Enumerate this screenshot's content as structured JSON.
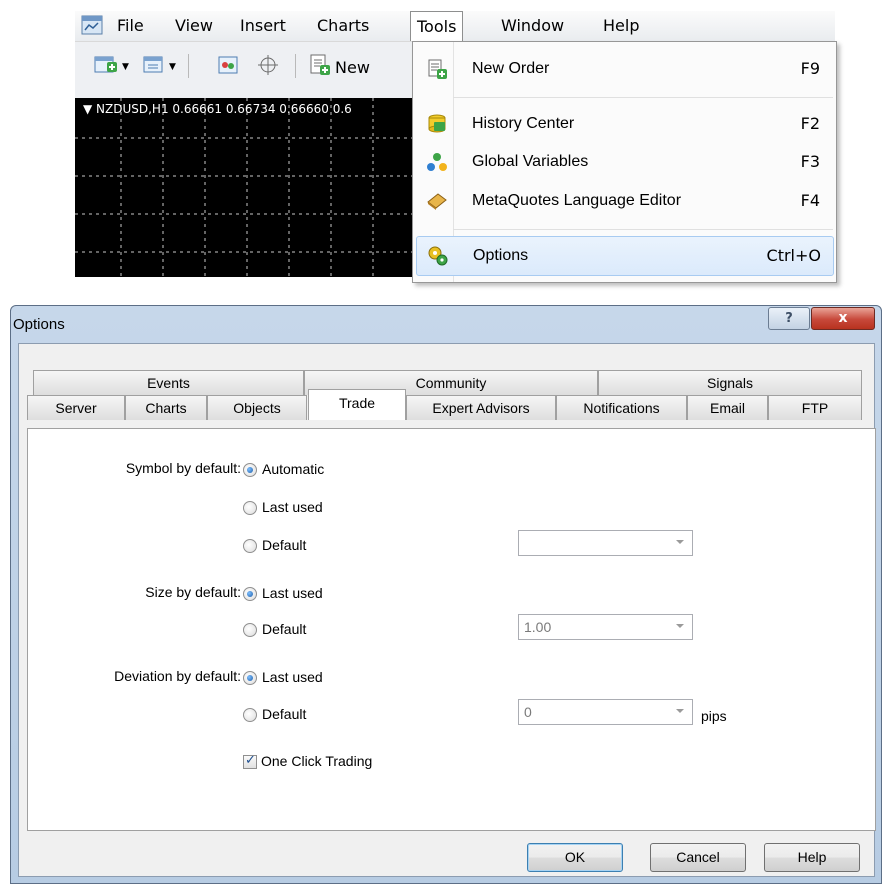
{
  "menubar": {
    "items": [
      "File",
      "View",
      "Insert",
      "Charts",
      "Tools",
      "Window",
      "Help"
    ],
    "open_item": "Tools"
  },
  "toolbar": {
    "new_order_partial": "New"
  },
  "chart": {
    "label": "▼ NZDUSD,H1  0.66661 0.66734 0.66660 0.6"
  },
  "tools_menu": {
    "items": [
      {
        "label": "New Order",
        "shortcut": "F9",
        "icon": "new-order-icon"
      },
      {
        "label": "History Center",
        "shortcut": "F2",
        "icon": "history-center-icon"
      },
      {
        "label": "Global Variables",
        "shortcut": "F3",
        "icon": "global-variables-icon"
      },
      {
        "label": "MetaQuotes Language Editor",
        "shortcut": "F4",
        "icon": "metaeditor-icon"
      },
      {
        "label": "Options",
        "shortcut": "Ctrl+O",
        "icon": "options-icon"
      }
    ],
    "selected": "Options"
  },
  "dialog": {
    "title": "Options",
    "help_button": "?",
    "close_button": "x",
    "tabs_row1": [
      "Events",
      "Community",
      "Signals"
    ],
    "tabs_row2": [
      "Server",
      "Charts",
      "Objects",
      "Trade",
      "Expert Advisors",
      "Notifications",
      "Email",
      "FTP"
    ],
    "active_tab": "Trade",
    "symbol": {
      "label": "Symbol by default:",
      "options": [
        "Automatic",
        "Last used",
        "Default"
      ],
      "selected": "Automatic",
      "combo_value": ""
    },
    "size": {
      "label": "Size by default:",
      "options": [
        "Last used",
        "Default"
      ],
      "selected": "Last used",
      "combo_value": "1.00"
    },
    "deviation": {
      "label": "Deviation by default:",
      "options": [
        "Last used",
        "Default"
      ],
      "selected": "Last used",
      "combo_value": "0",
      "unit": "pips"
    },
    "one_click": {
      "label": "One Click Trading",
      "checked": true
    },
    "buttons": {
      "ok": "OK",
      "cancel": "Cancel",
      "help": "Help"
    }
  }
}
